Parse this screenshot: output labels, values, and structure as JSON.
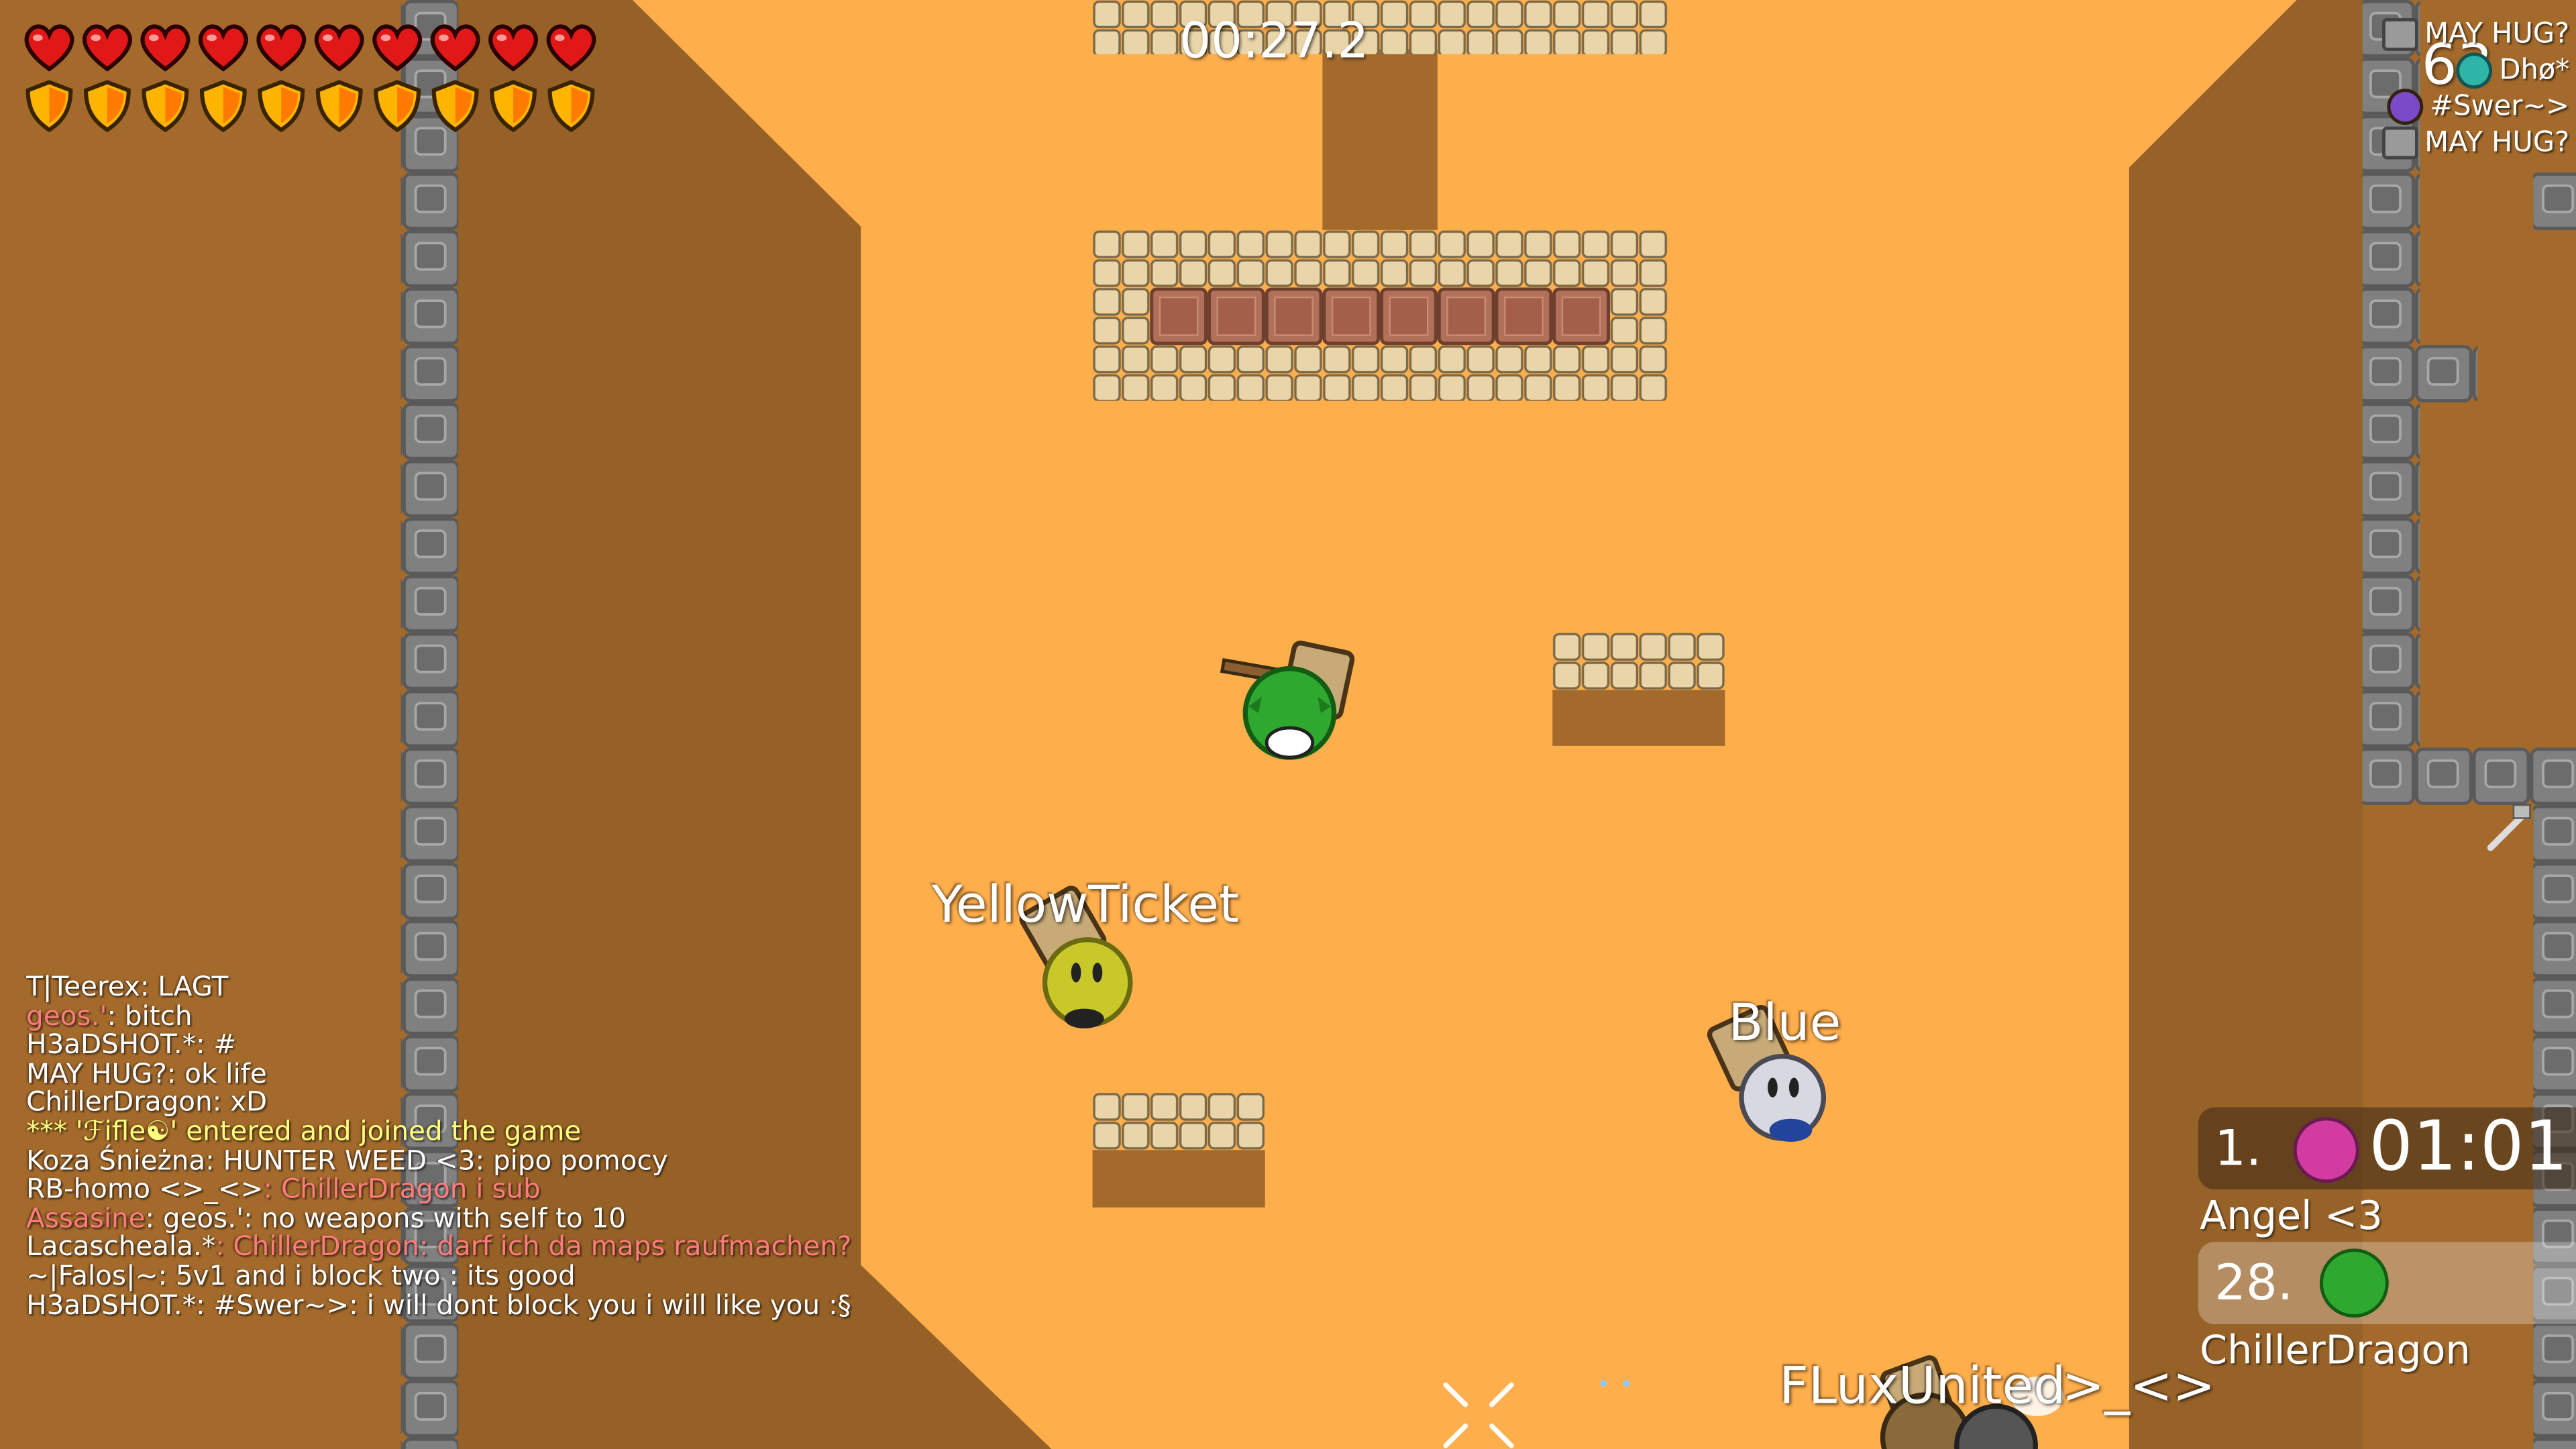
{
  "game": {
    "timer": "00:27.2",
    "health_count": 10,
    "armor_count": 10,
    "colors": {
      "sky": "#ffae4c",
      "dirt_dark": "#a36a2c",
      "dirt_mid": "#8c5a24",
      "tile_border": "#6f6f6f",
      "unhookable": "#7e7e7e",
      "chat_name": "#ff7c7c",
      "chat_system": "#ffff7c"
    }
  },
  "killfeed": {
    "score_partial": "63",
    "rows": [
      {
        "icon": "hammer-icon",
        "text": "MAY HUG?"
      },
      {
        "icon": "tee-icon",
        "text": "Dhø*"
      },
      {
        "icon": "tee-icon",
        "text": "#Swer~>"
      },
      {
        "icon": "hammer-icon",
        "text": "MAY HUG?"
      }
    ]
  },
  "players": [
    {
      "name": "YellowTicket",
      "color": "#c8c82a"
    },
    {
      "name": "Blue",
      "color": "#d8d8e0"
    },
    {
      "name": "",
      "color": "#2fa82f"
    },
    {
      "name": "FLuxUnited",
      "overlay": ">_<>"
    }
  ],
  "chat": [
    {
      "name": "T|Teerex",
      "text": ": LAGT",
      "name_color": "#ffffff"
    },
    {
      "name": "geos.'",
      "text": ": bitch",
      "name_color": "#ff7c7c"
    },
    {
      "name": "H3aDSHOT.*",
      "text": ": #",
      "name_color": "#ffffff"
    },
    {
      "name": "MAY HUG?",
      "text": ": ok life",
      "name_color": "#ffffff"
    },
    {
      "name": "ChillerDragon",
      "text": ": xD",
      "name_color": "#ffffff"
    },
    {
      "system": "*** 'ℱifle☯' entered and joined the game"
    },
    {
      "name": "Koza Śnieżna",
      "text": ": HUNTER WEED <3:  pipo pomocy",
      "name_color": "#ffffff"
    },
    {
      "name": "RB-homo <>_<>",
      "text": ": ChillerDragon i sub",
      "name_color": "#ffffff",
      "highlight": true
    },
    {
      "name": "Assasine",
      "text": ": geos.': no weapons with self to 10",
      "name_color": "#ff7c7c"
    },
    {
      "name": "Lacascheala.*",
      "text": ": ChillerDragon: darf ich da maps raufmachen?",
      "name_color": "#ffffff",
      "highlight": true
    },
    {
      "name": "~|Falos|~",
      "text": ": 5v1 and i block two : its good",
      "name_color": "#ffffff"
    },
    {
      "name": "H3aDSHOT.*",
      "text": ": #Swer~>: i will dont block you i will like you :§",
      "name_color": "#ffffff"
    }
  ],
  "scoreboard": [
    {
      "rank": "1.",
      "time": "01:01",
      "name": "Angel <3",
      "tee_color": "#d23ca0"
    },
    {
      "rank": "28.",
      "time": "",
      "name": "ChillerDragon",
      "tee_color": "#2fa82f"
    }
  ]
}
